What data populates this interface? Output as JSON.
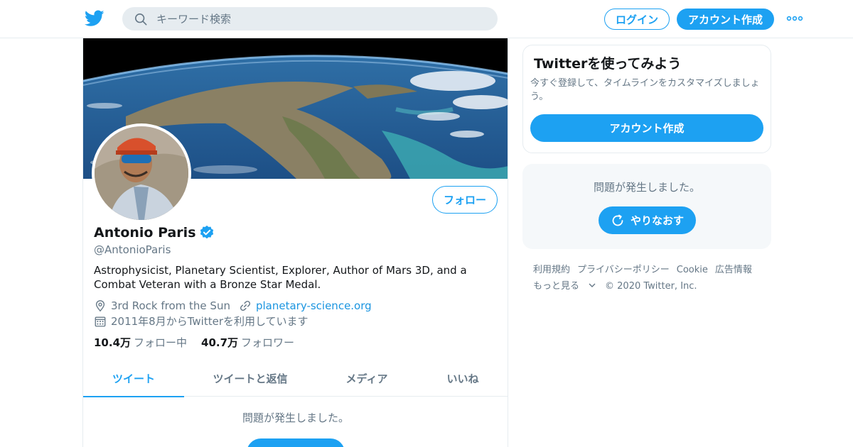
{
  "topbar": {
    "search_placeholder": "キーワード検索",
    "login_label": "ログイン",
    "signup_label": "アカウント作成"
  },
  "colors": {
    "accent": "#1da1f2",
    "text_primary": "#14171a",
    "text_secondary": "#657786",
    "link": "#1b95e0",
    "border": "#e6ecf0"
  },
  "profile": {
    "name": "Antonio Paris",
    "handle": "@AntonioParis",
    "follow_label": "フォロー",
    "bio": "Astrophysicist, Planetary Scientist, Explorer, Author of Mars 3D, and a Combat Veteran with a Bronze Star Medal.",
    "location": "3rd Rock from the Sun",
    "website": "planetary-science.org",
    "joined": "2011年8月からTwitterを利用しています",
    "following_count": "10.4万",
    "following_label": "フォロー中",
    "followers_count": "40.7万",
    "followers_label": "フォロワー"
  },
  "tabs": [
    {
      "label": "ツイート",
      "active": true
    },
    {
      "label": "ツイートと返信",
      "active": false
    },
    {
      "label": "メディア",
      "active": false
    },
    {
      "label": "いいね",
      "active": false
    }
  ],
  "timeline": {
    "error_message": "問題が発生しました。"
  },
  "signup_card": {
    "title": "Twitterを使ってみよう",
    "description": "今すぐ登録して、タイムラインをカスタマイズしましょう。",
    "button_label": "アカウント作成"
  },
  "error_card": {
    "message": "問題が発生しました。",
    "retry_label": "やりなおす"
  },
  "footer": {
    "links": [
      "利用規約",
      "プライバシーポリシー",
      "Cookie",
      "広告情報"
    ],
    "more_label": "もっと見る",
    "copyright": "© 2020 Twitter, Inc."
  },
  "icons": [
    "twitter-logo-icon",
    "search-icon",
    "more-icon",
    "verified-icon",
    "location-icon",
    "link-icon",
    "calendar-icon",
    "refresh-icon",
    "chevron-down-icon"
  ]
}
